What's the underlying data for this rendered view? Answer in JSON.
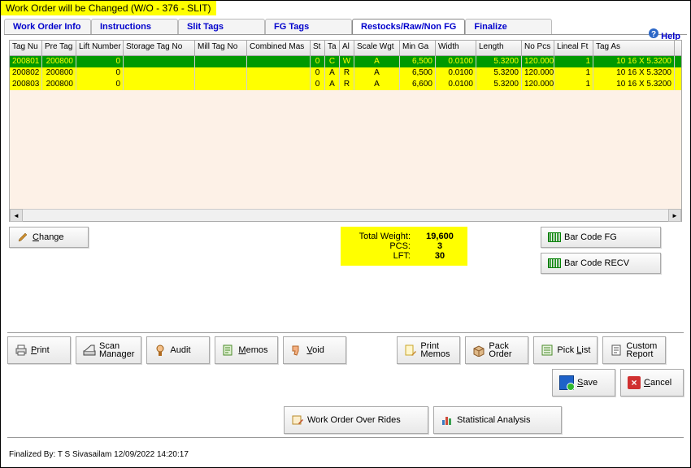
{
  "window": {
    "title": "Work Order will be Changed  (W/O - 376 - SLIT)"
  },
  "tabs": [
    {
      "label": "Work Order Info"
    },
    {
      "label": "Instructions"
    },
    {
      "label": "Slit Tags"
    },
    {
      "label": "FG Tags"
    },
    {
      "label": "Restocks/Raw/Non FG",
      "active": true
    },
    {
      "label": "Finalize"
    }
  ],
  "help": {
    "label": "Help"
  },
  "grid": {
    "headers": [
      "Tag Nu",
      "Pre Tag",
      "Lift Number",
      "Storage Tag No",
      "Mill Tag No",
      "Combined Mas",
      "St",
      "Ta",
      "Al",
      "Scale Wgt",
      "Min Ga",
      "Width",
      "Length",
      "No Pcs",
      "Lineal Ft",
      "Tag As"
    ],
    "rows": [
      {
        "style": "green",
        "cells": [
          "200801",
          "200800",
          "0",
          "",
          "",
          "",
          "0",
          "C",
          "W",
          "A",
          "6,500",
          "0.0100",
          "5.3200",
          "120.0000",
          "1",
          "10",
          "16 X  5.3200"
        ]
      },
      {
        "style": "yellow",
        "cells": [
          "200802",
          "200800",
          "0",
          "",
          "",
          "",
          "0",
          "A",
          "R",
          "A",
          "6,500",
          "0.0100",
          "5.3200",
          "120.0000",
          "1",
          "10",
          "16 X  5.3200"
        ]
      },
      {
        "style": "yellow",
        "cells": [
          "200803",
          "200800",
          "0",
          "",
          "",
          "",
          "0",
          "A",
          "R",
          "A",
          "6,600",
          "0.0100",
          "5.3200",
          "120.0000",
          "1",
          "10",
          "16 X  5.3200"
        ]
      }
    ]
  },
  "change_btn": {
    "label": "Change"
  },
  "totals": {
    "rows": [
      {
        "label": "Total Weight:",
        "value": "19,600"
      },
      {
        "label": "PCS:",
        "value": "3"
      },
      {
        "label": "LFT:",
        "value": "30"
      }
    ]
  },
  "barcode": {
    "fg": "Bar Code FG",
    "recv": "Bar Code RECV"
  },
  "toolbar": {
    "print": "Print",
    "scan_manager": "Scan\nManager",
    "audit": "Audit",
    "memos": "Memos",
    "void": "Void",
    "print_memos": "Print\nMemos",
    "pack_order": "Pack\nOrder",
    "pick_list": "Pick List",
    "custom_report": "Custom\nReport",
    "save": "Save",
    "cancel": "Cancel",
    "wo_overrides": "Work Order Over Rides",
    "stat_analysis": "Statistical Analysis"
  },
  "status": {
    "text": "Finalized By: T S Sivasailam 12/09/2022 14:20:17"
  }
}
